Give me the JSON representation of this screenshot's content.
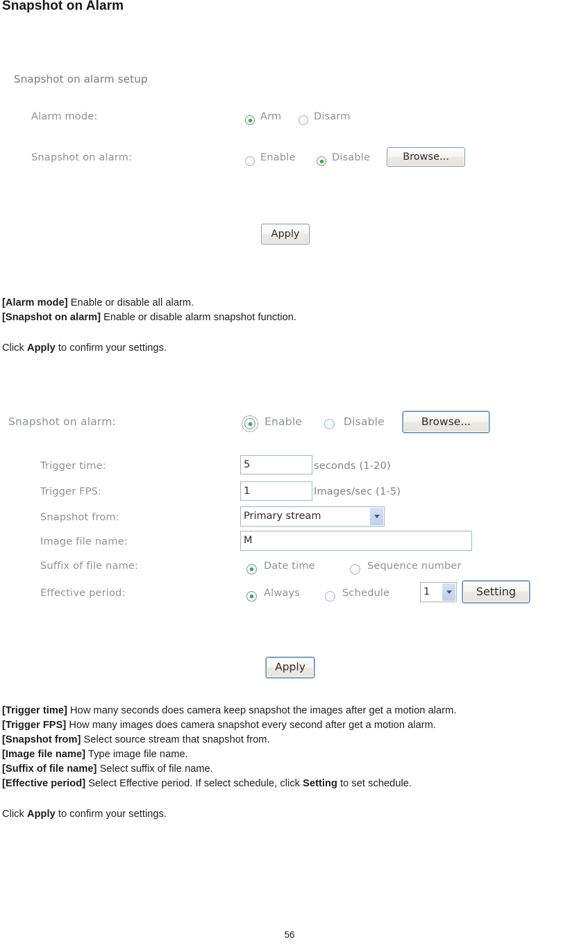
{
  "document": {
    "heading": "Snapshot on Alarm",
    "page_number": "56"
  },
  "figure_one": {
    "section_title": "Snapshot on alarm setup",
    "rows": [
      {
        "label": "Alarm mode:",
        "options": [
          "Arm",
          "Disarm"
        ],
        "selected": "Arm"
      },
      {
        "label": "Snapshot on alarm:",
        "options": [
          "Enable",
          "Disable"
        ],
        "selected": "Disable",
        "browse_label": "Browse..."
      }
    ],
    "apply_label": "Apply"
  },
  "description_one": {
    "lines": [
      {
        "term": "[Alarm mode]",
        "text": " Enable or disable all alarm."
      },
      {
        "term": "[Snapshot on alarm]",
        "text": " Enable or disable alarm snapshot function."
      }
    ],
    "click_prefix": "Click ",
    "click_term": "Apply",
    "click_suffix": " to confirm your settings."
  },
  "figure_two": {
    "header": {
      "label": "Snapshot on alarm:",
      "options": [
        "Enable",
        "Disable"
      ],
      "selected": "Enable",
      "browse_label": "Browse..."
    },
    "trigger_time": {
      "label": "Trigger time:",
      "value": "5",
      "unit": "seconds (1-20)"
    },
    "trigger_fps": {
      "label": "Trigger FPS:",
      "value": "1",
      "unit": "Images/sec (1-5)"
    },
    "snapshot_from": {
      "label": "Snapshot from:",
      "value": "Primary stream"
    },
    "image_file_name": {
      "label": "Image file name:",
      "value": "M"
    },
    "suffix_of_file_name": {
      "label": "Suffix of file name:",
      "options": [
        "Date time",
        "Sequence number"
      ],
      "selected": "Date time"
    },
    "effective_period": {
      "label": "Effective period:",
      "options": [
        "Always",
        "Schedule"
      ],
      "selected": "Always",
      "schedule_value": "1",
      "setting_label": "Setting"
    },
    "apply_label": "Apply"
  },
  "description_two": {
    "lines": [
      {
        "term": "[Trigger time]",
        "text": " How many seconds does camera keep snapshot the images after get a motion alarm."
      },
      {
        "term": "[Trigger FPS]",
        "text": " How many images does camera snapshot every second after get a motion alarm."
      },
      {
        "term": "[Snapshot from]",
        "text": " Select source stream that snapshot from."
      },
      {
        "term": "[Image file name]",
        "text": " Type image file name."
      },
      {
        "term": "[Suffix of file name]",
        "text": " Select suffix of file name."
      }
    ],
    "effective_line": {
      "term": "[Effective period]",
      "text_before": " Select Effective period. If select schedule, click ",
      "emphasis": "Setting",
      "text_after": " to set schedule."
    },
    "click_prefix": "Click ",
    "click_term": "Apply",
    "click_suffix": " to confirm your settings."
  }
}
